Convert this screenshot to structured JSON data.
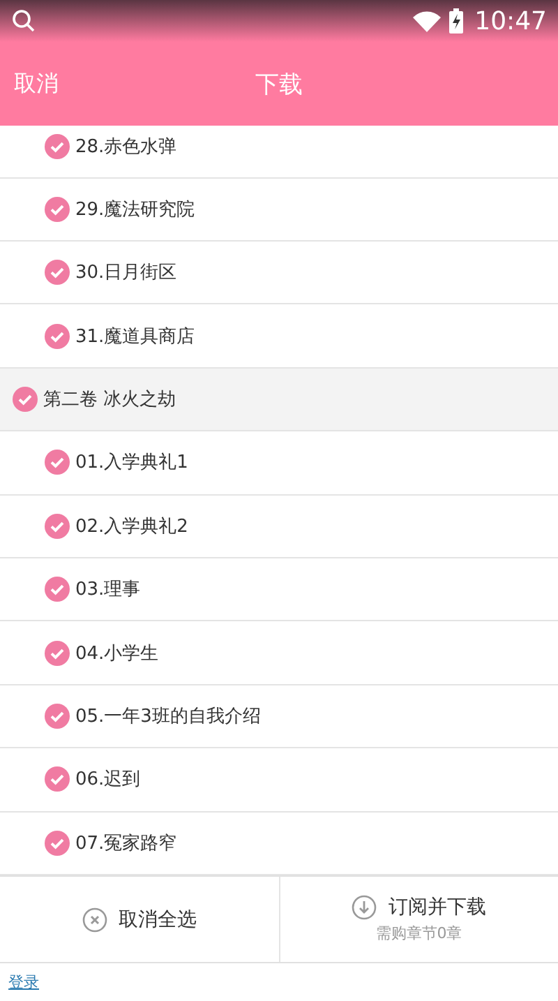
{
  "status_bar": {
    "time": "10:47"
  },
  "header": {
    "cancel": "取消",
    "title": "下载"
  },
  "continued_chapters": [
    {
      "title": "28.赤色水弹",
      "checked": true
    },
    {
      "title": "29.魔法研究院",
      "checked": true
    },
    {
      "title": "30.日月街区",
      "checked": true
    },
    {
      "title": "31.魔道具商店",
      "checked": true
    }
  ],
  "volumes": [
    {
      "title": "第二卷 冰火之劫",
      "checked": true,
      "children": [
        {
          "title": "01.入学典礼1",
          "checked": true
        },
        {
          "title": "02.入学典礼2",
          "checked": true
        },
        {
          "title": "03.理事",
          "checked": true
        },
        {
          "title": "04.小学生",
          "checked": true
        },
        {
          "title": "05.一年3班的自我介绍",
          "checked": true
        },
        {
          "title": "06.迟到",
          "checked": true
        },
        {
          "title": "07.冤家路窄",
          "checked": true
        }
      ]
    }
  ],
  "actions": {
    "deselect_all": "取消全选",
    "subscribe": "订阅并下载",
    "subscribe_note": "需购章节0章"
  },
  "footer": {
    "login": "登录"
  }
}
